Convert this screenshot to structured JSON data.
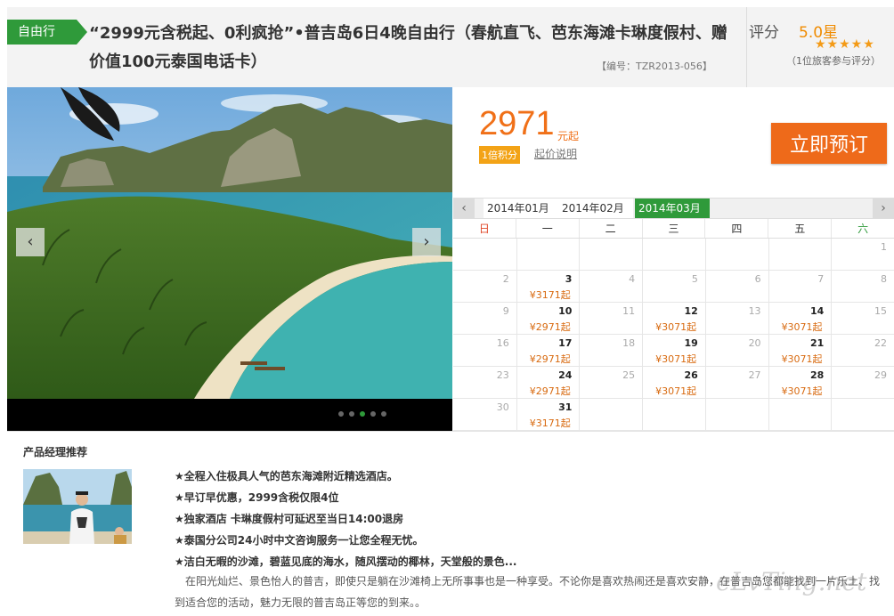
{
  "header": {
    "badge": "自由行",
    "title": "“2999元含税起、0利疯抢”•普吉岛6日4晚自由行（春航直飞、芭东海滩卡琳度假村、赠价值100元泰国电话卡）",
    "code": "【编号：TZR2013-056】",
    "rating_label": "评分",
    "rating_value": "5.0星",
    "stars": "★★★★★",
    "review_count": "（1位旅客参与评分）"
  },
  "gallery": {
    "prev_label": "‹",
    "next_label": "›",
    "slide_count": 5,
    "active_slide": 3
  },
  "price": {
    "amount": "2971",
    "suffix": "元起",
    "points_badge": "1倍积分",
    "note_link": "起价说明",
    "book_button": "立即预订"
  },
  "calendar": {
    "prev_label": "‹",
    "next_label": "›",
    "months": [
      "2014年01月",
      "2014年02月",
      "2014年03月"
    ],
    "active_month": 2,
    "weekdays": [
      "日",
      "一",
      "二",
      "三",
      "四",
      "五",
      "六"
    ],
    "first_weekday": 6,
    "days_in_month": 31,
    "watermark": "3",
    "prices": {
      "3": "¥3171起",
      "10": "¥2971起",
      "12": "¥3071起",
      "14": "¥3071起",
      "17": "¥2971起",
      "19": "¥3071起",
      "21": "¥3071起",
      "24": "¥2971起",
      "26": "¥3071起",
      "28": "¥3071起",
      "31": "¥3171起"
    }
  },
  "manager": {
    "title": "产品经理推荐",
    "points": [
      "★全程入住极具人气的芭东海滩附近精选酒店。",
      "★早订早优惠，2999含税仅限4位",
      "★独家酒店 卡琳度假村可延迟至当日14:00退房",
      "★泰国分公司24小时中文咨询服务一让您全程无忧。",
      "★洁白无暇的沙滩，碧蓝见底的海水，随风摆动的椰林，天堂般的景色..."
    ],
    "description": "在阳光灿烂、景色怡人的普吉，即使只是躺在沙滩椅上无所事事也是一种享受。不论你是喜欢热闹还是喜欢安静，在普吉岛您都能找到一片乐土、找到适合您的活动，魅力无限的普吉岛正等您的到来。。",
    "brand_watermark": "eLvTing.net"
  },
  "colors": {
    "accent_green": "#2f9a3a",
    "price_orange": "#f07018",
    "book_orange": "#ee6a1a"
  }
}
